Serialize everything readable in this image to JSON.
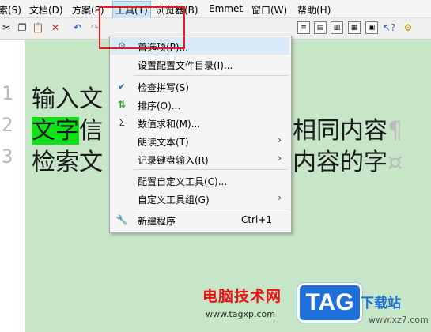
{
  "menubar": {
    "items": [
      "索(S)",
      "文档(D)",
      "方案(P)",
      "工具(T)",
      "浏览器(B)",
      "Emmet",
      "窗口(W)",
      "帮助(H)"
    ]
  },
  "toolbar": {
    "icons": [
      "scissors-icon",
      "copy-icon",
      "paste-icon",
      "delete-icon",
      "undo-icon",
      "redo-icon",
      "view1-icon",
      "view2-icon",
      "view3-icon",
      "view4-icon",
      "view5-icon",
      "view6-icon",
      "help-cursor-icon",
      "tool-icon"
    ]
  },
  "editor": {
    "line_numbers": [
      "1",
      "2",
      "3"
    ],
    "lines": [
      {
        "text": "输入文",
        "highlight": "",
        "rest": ""
      },
      {
        "text": "",
        "highlight": "文字",
        "rest": "信",
        "tail": "相同内容",
        "mark": "¶"
      },
      {
        "text": "检索文",
        "tail": "内容的字",
        "mark": "¤"
      }
    ]
  },
  "tools_menu": {
    "items": [
      {
        "icon": "gear-icon",
        "label": "首选项(P)...",
        "selected": true
      },
      {
        "icon": "",
        "label": "设置配置文件目录(I)..."
      },
      {
        "icon": "spellcheck-icon",
        "label": "检查拼写(S)"
      },
      {
        "icon": "sort-icon",
        "label": "排序(O)..."
      },
      {
        "icon": "sigma-icon",
        "label": "数值求和(M)..."
      },
      {
        "icon": "",
        "label": "朗读文本(T)",
        "submenu": true
      },
      {
        "icon": "",
        "label": "记录键盘输入(R)",
        "submenu": true
      },
      {
        "icon": "",
        "label": "配置自定义工具(C)..."
      },
      {
        "icon": "",
        "label": "自定义工具组(G)",
        "submenu": true
      },
      {
        "icon": "wrench-icon",
        "label": "新建程序",
        "shortcut": "Ctrl+1"
      }
    ],
    "arrow": "›"
  },
  "watermark": {
    "title": "电脑技术网",
    "url": "www.tagxp.com",
    "tag": "TAG",
    "site": "载站",
    "site_prefix": "下",
    "xz": "www.xz7.com"
  },
  "colors": {
    "editor_bg": "#c7e6c7",
    "highlight": "#10e21a",
    "accent_red": "#e21c23",
    "tag_blue": "#1e6fd9"
  }
}
